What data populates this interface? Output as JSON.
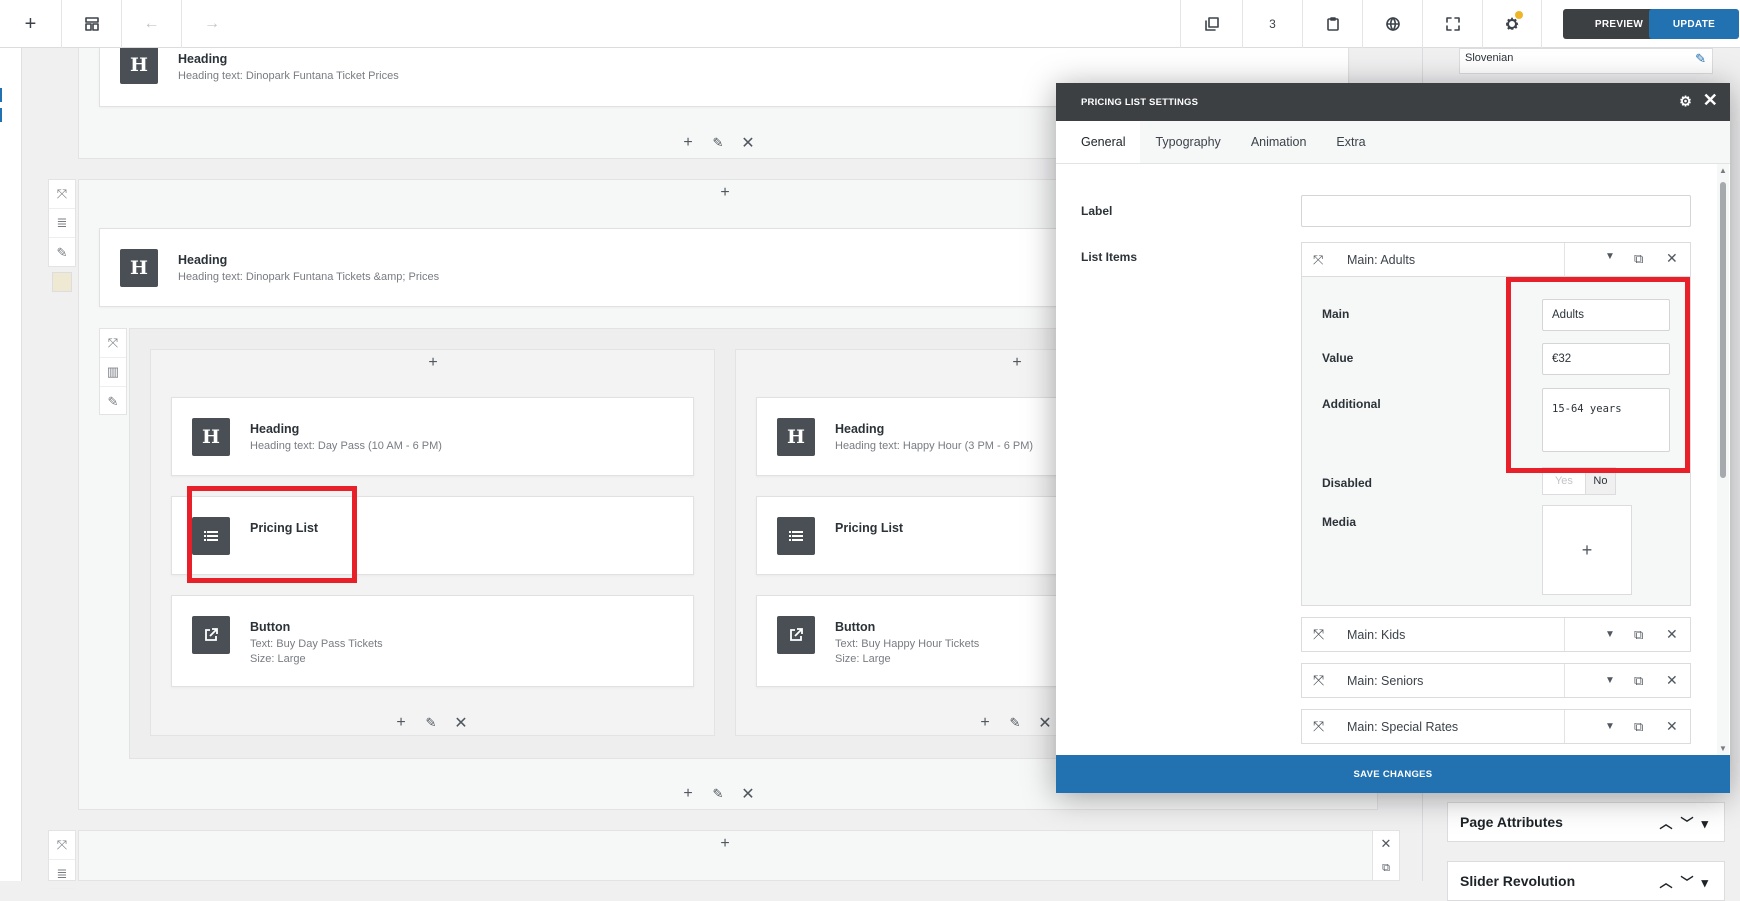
{
  "toolbar": {
    "add": "+",
    "back": "←",
    "forward": "→",
    "revision_count": "3",
    "preview": "PREVIEW",
    "update": "UPDATE"
  },
  "builder": {
    "top_heading": {
      "title": "Heading",
      "sub": "Heading text: Dinopark Funtana Ticket Prices"
    },
    "mid_heading": {
      "title": "Heading",
      "sub": "Heading text: Dinopark Funtana Tickets &amp; Prices"
    },
    "col1": {
      "heading": {
        "title": "Heading",
        "sub": "Heading text: Day Pass (10 AM - 6 PM)"
      },
      "pricing": {
        "title": "Pricing List"
      },
      "button": {
        "title": "Button",
        "sub1": "Text: Buy Day Pass Tickets",
        "sub2": "Size: Large"
      }
    },
    "col2": {
      "heading": {
        "title": "Heading",
        "sub": "Heading text: Happy Hour (3 PM - 6 PM)"
      },
      "pricing": {
        "title": "Pricing List"
      },
      "button": {
        "title": "Button",
        "sub1": "Text: Buy Happy Hour Tickets",
        "sub2": "Size: Large"
      }
    }
  },
  "sidebar": {
    "language": "Slovenian",
    "page_attributes": "Page Attributes",
    "slider_revolution": "Slider Revolution"
  },
  "modal": {
    "title": "PRICING LIST SETTINGS",
    "tabs": [
      "General",
      "Typography",
      "Animation",
      "Extra"
    ],
    "label_label": "Label",
    "label_value": "",
    "list_items_label": "List Items",
    "items": [
      "Main: Adults",
      "Main: Kids",
      "Main: Seniors",
      "Main: Special Rates"
    ],
    "expanded": {
      "main_label": "Main",
      "main_value": "Adults",
      "value_label": "Value",
      "value_value": "€32",
      "additional_label": "Additional",
      "additional_value": "15-64 years",
      "disabled_label": "Disabled",
      "yes": "Yes",
      "no": "No",
      "media_label": "Media",
      "media_add": "+"
    },
    "save": "SAVE CHANGES"
  },
  "colors": {
    "accent": "#2271b1",
    "dark": "#3c4043",
    "highlight": "#e8202a"
  }
}
